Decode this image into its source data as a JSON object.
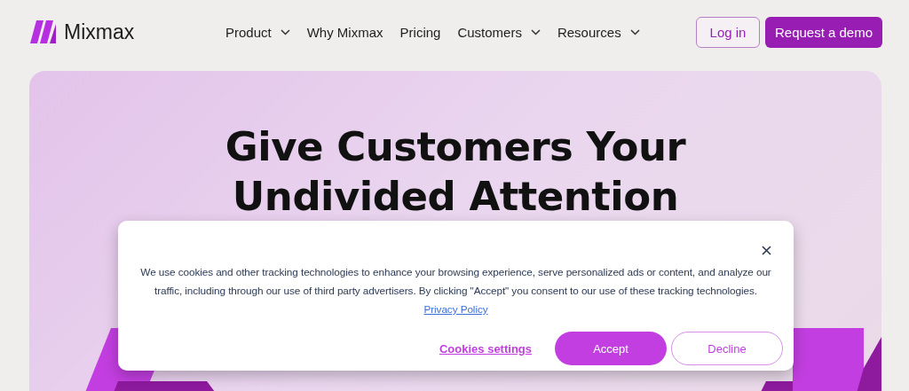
{
  "header": {
    "logo": "Mixmax",
    "nav": [
      {
        "label": "Product",
        "dropdown": true
      },
      {
        "label": "Why Mixmax",
        "dropdown": false
      },
      {
        "label": "Pricing",
        "dropdown": false
      },
      {
        "label": "Customers",
        "dropdown": true
      },
      {
        "label": "Resources",
        "dropdown": true
      }
    ],
    "login": "Log in",
    "demo": "Request a demo"
  },
  "hero": {
    "headline": [
      "Give Customers Your",
      "Undivided Attention"
    ]
  },
  "cookie_banner": {
    "text": "We use cookies and other tracking technologies to enhance your browsing experience, serve personalized ads or content, and analyze our traffic, including through our use of third party advertisers. By clicking \"Accept\" you consent to our use of these tracking technologies.",
    "link": "Privacy Policy",
    "settings": "Cookies settings",
    "accept": "Accept",
    "decline": "Decline"
  }
}
